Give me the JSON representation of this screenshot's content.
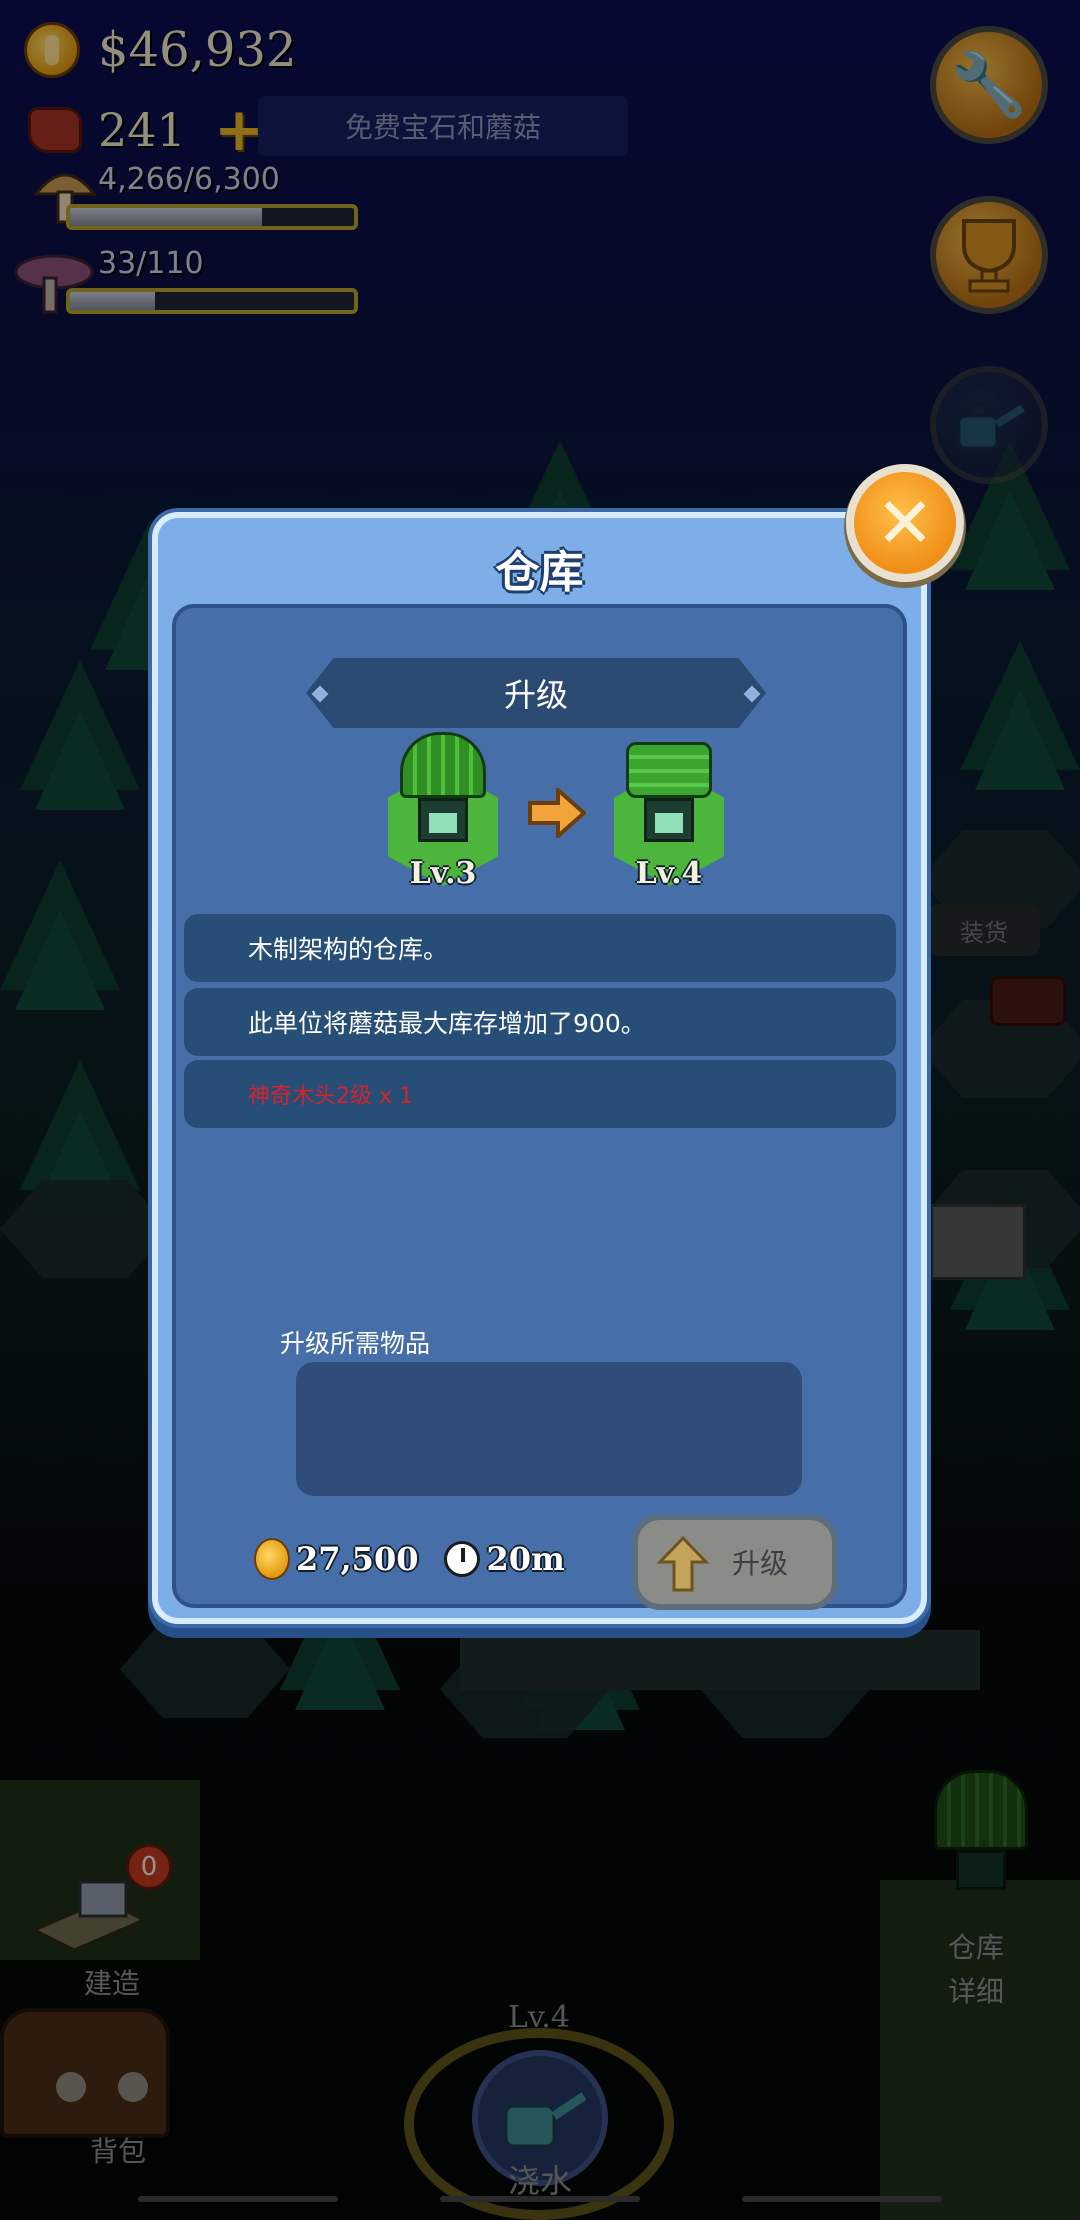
{
  "hud": {
    "money": "$46,932",
    "gems": "241",
    "free_gems_label": "免费宝石和蘑菇",
    "mushroom_progress": "4,266/6,300",
    "mushroom_fill": 0.677,
    "purple_progress": "33/110",
    "purple_fill": 0.3
  },
  "dialog": {
    "title": "仓库",
    "banner": "升级",
    "from_level": "Lv.3",
    "to_level": "Lv.4",
    "rows": [
      "木制架构的仓库。",
      "此单位将蘑菇最大库存增加了900。",
      "神奇木头2级 x 1"
    ],
    "required_items_label": "升级所需物品",
    "cost_coins": "27,500",
    "cost_time": "20m",
    "upgrade_button": "升级"
  },
  "world": {
    "unload_label": "装货"
  },
  "dock": {
    "build_label": "建造",
    "build_badge": "0",
    "bag_label": "背包",
    "water_level": "Lv.4",
    "water_label": "浇水",
    "warehouse_label": "仓库",
    "details_label": "详细"
  },
  "colors": {
    "dialog_bg": "#7eaee8",
    "inner_panel": "#466ea8",
    "row_bg": "#274e76",
    "requirement_red": "#d6232c",
    "close_orange": "#f08e18"
  },
  "icons": {
    "currency": "coin-icon",
    "gem": "gem-icon",
    "settings": "wrench-icon",
    "achievements": "trophy-icon",
    "watering": "watering-can-icon",
    "close": "close-icon",
    "time": "clock-icon"
  }
}
